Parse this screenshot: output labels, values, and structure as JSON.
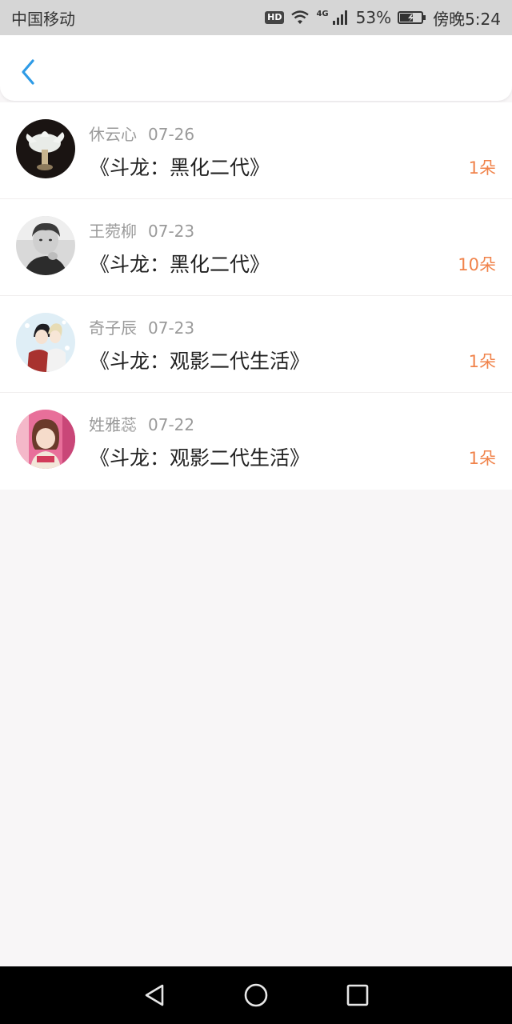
{
  "status_bar": {
    "carrier": "中国移动",
    "network": "4G",
    "battery": "53%",
    "time": "傍晚5:24",
    "icons": [
      "hd-icon",
      "wifi-icon",
      "signal-icon",
      "battery-icon"
    ]
  },
  "header": {
    "back_icon": "chevron-left-icon"
  },
  "colors": {
    "accent": "#2e9be6",
    "count": "#f0834b",
    "meta": "#9a9a9a",
    "background": "#f8f6f7"
  },
  "records": [
    {
      "name": "休云心",
      "date": "07-26",
      "title": "《斗龙：黑化二代》",
      "count": "1朵"
    },
    {
      "name": "王菀柳",
      "date": "07-23",
      "title": "《斗龙：黑化二代》",
      "count": "10朵"
    },
    {
      "name": "奇子辰",
      "date": "07-23",
      "title": "《斗龙：观影二代生活》",
      "count": "1朵"
    },
    {
      "name": "姓雅蕊",
      "date": "07-22",
      "title": "《斗龙：观影二代生活》",
      "count": "1朵"
    }
  ],
  "nav_bar": {
    "icons": [
      "back-triangle-icon",
      "home-circle-icon",
      "recents-square-icon"
    ]
  }
}
